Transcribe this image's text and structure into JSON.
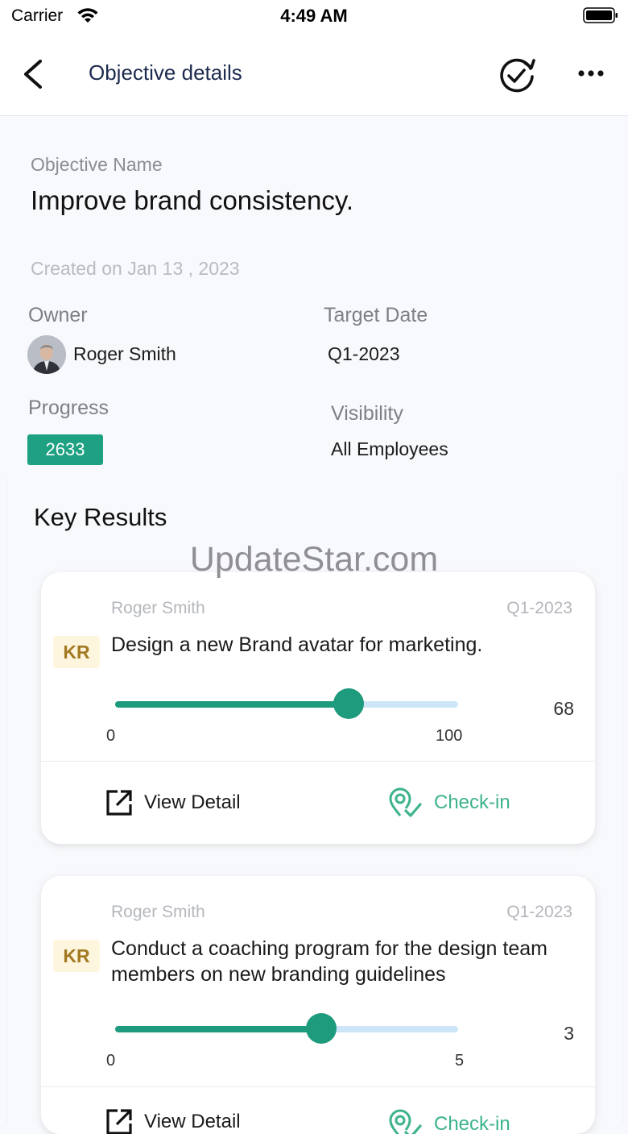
{
  "status_bar": {
    "carrier": "Carrier",
    "time": "4:49 AM"
  },
  "nav": {
    "title": "Objective details"
  },
  "objective": {
    "name_label": "Objective Name",
    "name": "Improve brand consistency.",
    "created": "Created on Jan 13 , 2023",
    "owner_label": "Owner",
    "owner_name": "Roger Smith",
    "target_label": "Target Date",
    "target_value": "Q1-2023",
    "progress_label": "Progress",
    "progress_value": "2633",
    "visibility_label": "Visibility",
    "visibility_value": "All Employees"
  },
  "key_results": {
    "heading": "Key Results",
    "watermark": "UpdateStar.com",
    "items": [
      {
        "owner": "Roger Smith",
        "date": "Q1-2023",
        "tag": "KR",
        "title": "Design a new Brand avatar for marketing.",
        "min": "0",
        "max": "100",
        "value": "68",
        "progress_fraction": 0.68,
        "view_label": "View Detail",
        "checkin_label": "Check-in"
      },
      {
        "owner": "Roger Smith",
        "date": "Q1-2023",
        "tag": "KR",
        "title": "Conduct a coaching program for the design team members on new branding guidelines",
        "min": "0",
        "max": "5",
        "value": "3",
        "progress_fraction": 0.6,
        "view_label": "View Detail",
        "checkin_label": "Check-in"
      }
    ]
  },
  "colors": {
    "accent": "#1ea082",
    "checkin": "#3db38a",
    "kr_tag_bg": "#fdf5de",
    "kr_tag_text": "#a37a22",
    "track": "#cde6f7"
  },
  "icons": {
    "back": "chevron-left-icon",
    "check_cycle": "check-cycle-icon",
    "more": "more-horizontal-icon",
    "view_detail": "external-link-icon",
    "check_in": "location-check-icon"
  }
}
